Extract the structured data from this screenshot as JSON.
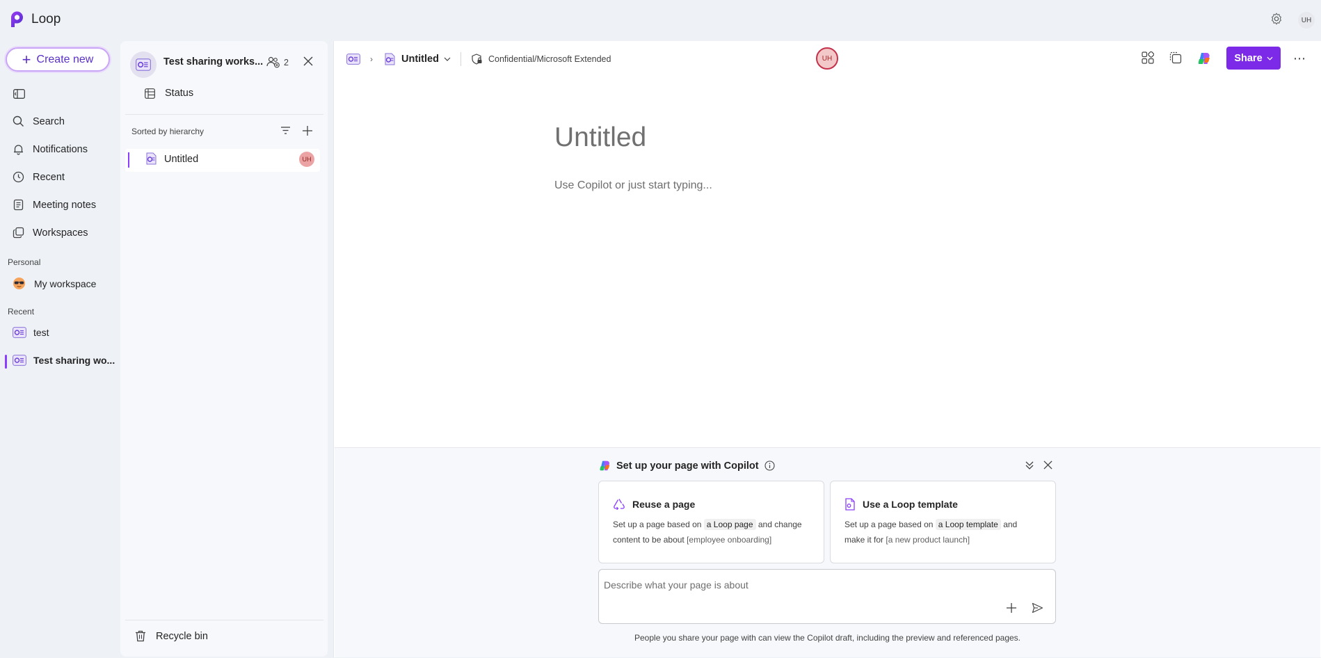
{
  "app": {
    "name": "Loop",
    "user_initials": "UH"
  },
  "nav": {
    "create_label": "Create new",
    "items": [
      {
        "label": "Search"
      },
      {
        "label": "Notifications"
      },
      {
        "label": "Recent"
      },
      {
        "label": "Meeting notes"
      },
      {
        "label": "Workspaces"
      }
    ],
    "personal_label": "Personal",
    "my_workspace_label": "My workspace",
    "recent_label": "Recent",
    "recent_items": [
      {
        "label": "test"
      },
      {
        "label": "Test sharing wo..."
      }
    ]
  },
  "workspace": {
    "title": "Test sharing works...",
    "member_count": "2",
    "status_label": "Status",
    "sorted_label": "Sorted by hierarchy",
    "tree": [
      {
        "label": "Untitled",
        "avatar": "UH"
      }
    ],
    "recycle_label": "Recycle bin"
  },
  "doc": {
    "breadcrumb_page": "Untitled",
    "sensitivity_label": "Confidential/Microsoft Extended",
    "collaborator_initials": "UH",
    "share_label": "Share",
    "title_placeholder": "Untitled",
    "body_placeholder": "Use Copilot or just start typing..."
  },
  "copilot": {
    "header": "Set up your page with Copilot",
    "cards": [
      {
        "title": "Reuse a page",
        "text1": "Set up a page based on",
        "chip": "a Loop page",
        "text2": "and change",
        "text3": "content to be about",
        "example": "[employee onboarding]"
      },
      {
        "title": "Use a Loop template",
        "text1": "Set up a page based on",
        "chip": "a Loop template",
        "text2": "and",
        "text3": "make it for",
        "example": "[a new product launch]"
      }
    ],
    "prompt_placeholder": "Describe what your page is about",
    "disclaimer": "People you share your page with can view the Copilot draft, including the preview and referenced pages."
  },
  "colors": {
    "accent": "#7d2ae8",
    "avatar_red": "#c4314b",
    "background": "#eef2f7"
  }
}
